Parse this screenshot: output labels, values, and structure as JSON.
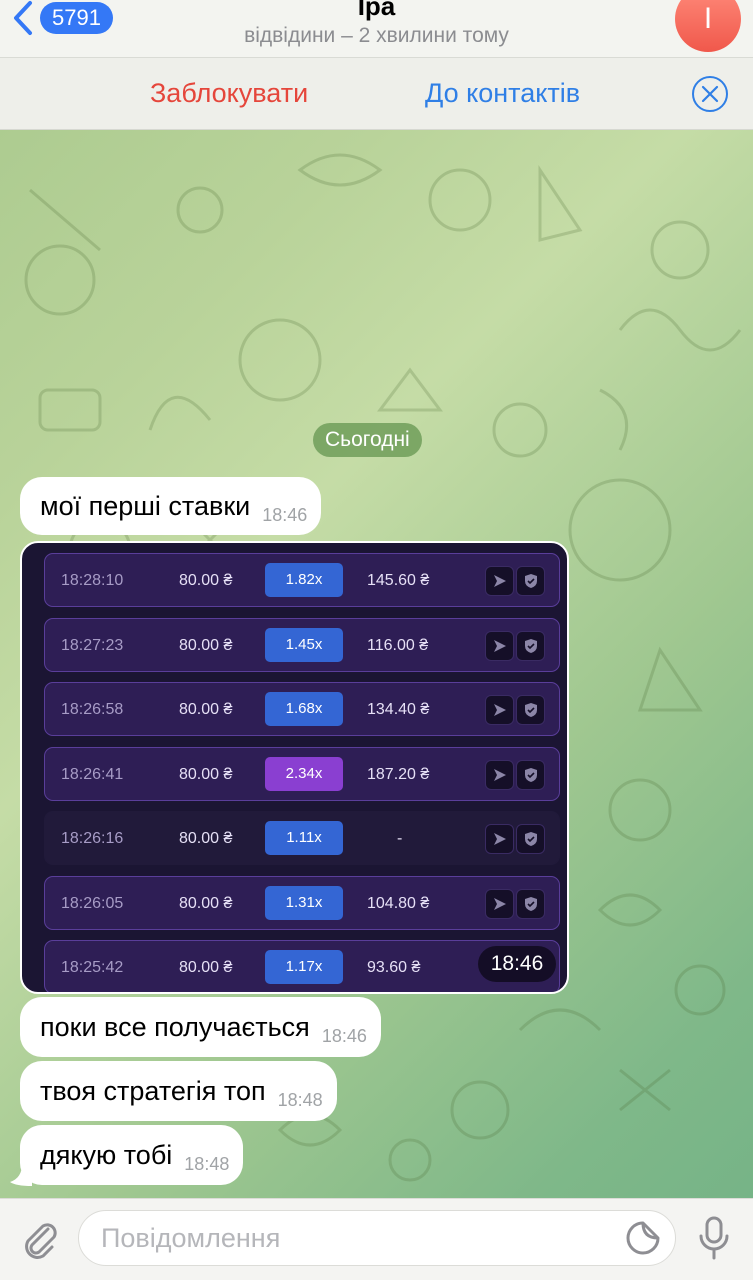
{
  "header": {
    "back_count": "5791",
    "title": "Іра",
    "status": "відвідини – 2 хвилини тому",
    "avatar_letter": "І",
    "avatar_color": "#f0584b"
  },
  "actionbar": {
    "block_label": "Заблокувати",
    "contacts_label": "До контактів"
  },
  "date_label": "Сьогодні",
  "messages_top": [
    {
      "text": "мої перші ставки",
      "time": "18:46"
    }
  ],
  "bets_image": {
    "time": "18:46",
    "rows": [
      {
        "time": "18:28:10",
        "bet": "80.00 ₴",
        "mult": "1.82x",
        "win": "145.60 ₴",
        "color": "blue"
      },
      {
        "time": "18:27:23",
        "bet": "80.00 ₴",
        "mult": "1.45x",
        "win": "116.00 ₴",
        "color": "blue"
      },
      {
        "time": "18:26:58",
        "bet": "80.00 ₴",
        "mult": "1.68x",
        "win": "134.40 ₴",
        "color": "blue"
      },
      {
        "time": "18:26:41",
        "bet": "80.00 ₴",
        "mult": "2.34x",
        "win": "187.20 ₴",
        "color": "purple"
      },
      {
        "time": "18:26:16",
        "bet": "80.00 ₴",
        "mult": "1.11x",
        "win": "-",
        "color": "blue",
        "lost": true
      },
      {
        "time": "18:26:05",
        "bet": "80.00 ₴",
        "mult": "1.31x",
        "win": "104.80 ₴",
        "color": "blue"
      },
      {
        "time": "18:25:42",
        "bet": "80.00 ₴",
        "mult": "1.17x",
        "win": "93.60 ₴",
        "color": "blue"
      }
    ]
  },
  "messages_bottom": [
    {
      "text": "поки все получається",
      "time": "18:46"
    },
    {
      "text": "твоя стратегія топ",
      "time": "18:48"
    },
    {
      "text": "дякую тобі",
      "time": "18:48"
    }
  ],
  "composer": {
    "placeholder": "Повідомлення"
  }
}
